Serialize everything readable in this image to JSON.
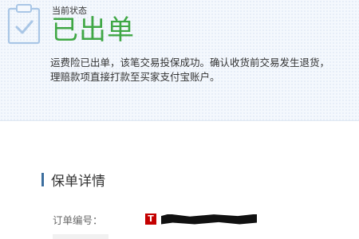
{
  "status": {
    "caption": "当前状态",
    "value": "已出单",
    "message_lines": [
      "运费险已出单，该笔交易投保成功。确认收货前交易发生退货，",
      "理赔款项直接打款至买家支付宝账户。"
    ],
    "icon": "clipboard-check-icon",
    "accent_color": "#3fa745"
  },
  "policy_details": {
    "title": "保单详情",
    "order_number_label": "订单编号：",
    "badge_text": "T",
    "badge_icon": "tmall-icon",
    "badge_color": "#c40000"
  }
}
